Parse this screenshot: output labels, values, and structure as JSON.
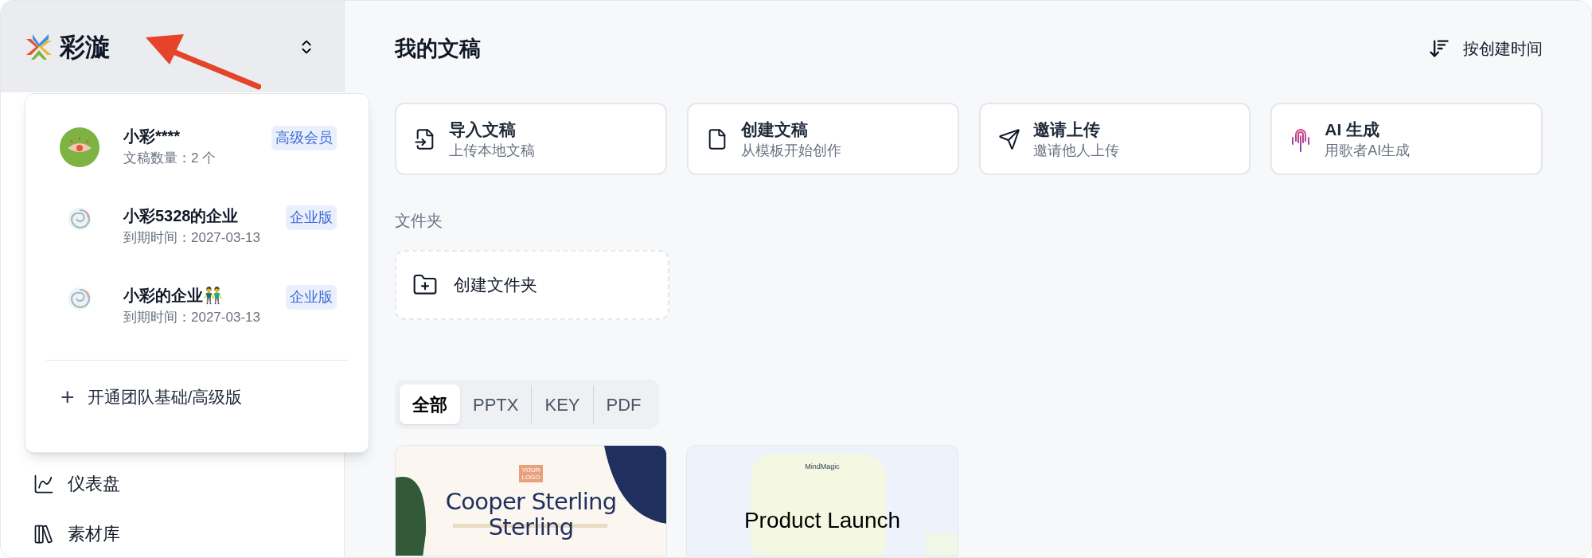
{
  "brand": {
    "name": "彩漩"
  },
  "account_menu": {
    "accounts": [
      {
        "kind": "personal",
        "name": "小彩****",
        "detail": "文稿数量：2 个",
        "badge": "高级会员"
      },
      {
        "kind": "team",
        "name": "小彩5328的企业",
        "detail": "到期时间：2027-03-13",
        "badge": "企业版"
      },
      {
        "kind": "team",
        "name": "小彩的企业👬",
        "detail": "到期时间：2027-03-13",
        "badge": "企业版"
      }
    ],
    "action": {
      "icon": "+",
      "label": "开通团队基础/高级版"
    }
  },
  "sidebar": {
    "items": [
      {
        "kind": "chart",
        "label": "仪表盘"
      },
      {
        "kind": "library",
        "label": "素材库"
      }
    ]
  },
  "page": {
    "title": "我的文稿",
    "sort": "按创建时间"
  },
  "actions": [
    {
      "kind": "import",
      "title": "导入文稿",
      "subtitle": "上传本地文稿"
    },
    {
      "kind": "file",
      "title": "创建文稿",
      "subtitle": "从模板开始创作"
    },
    {
      "kind": "send",
      "title": "邀请上传",
      "subtitle": "邀请他人上传"
    },
    {
      "kind": "ai",
      "title": "AI 生成",
      "subtitle": "用歌者AI生成"
    }
  ],
  "folders": {
    "heading": "文件夹",
    "create": "创建文件夹"
  },
  "filter_tabs": [
    {
      "label": "全部",
      "selected": true
    },
    {
      "label": "PPTX",
      "selected": false
    },
    {
      "label": "KEY",
      "selected": false
    },
    {
      "label": "PDF",
      "selected": false
    }
  ],
  "documents": [
    {
      "kind": "agency",
      "logo": "YOUR LOGO",
      "title": "Cooper Sterling Sterling"
    },
    {
      "kind": "launch",
      "brand": "MindMagic",
      "title": "Product Launch"
    }
  ]
}
